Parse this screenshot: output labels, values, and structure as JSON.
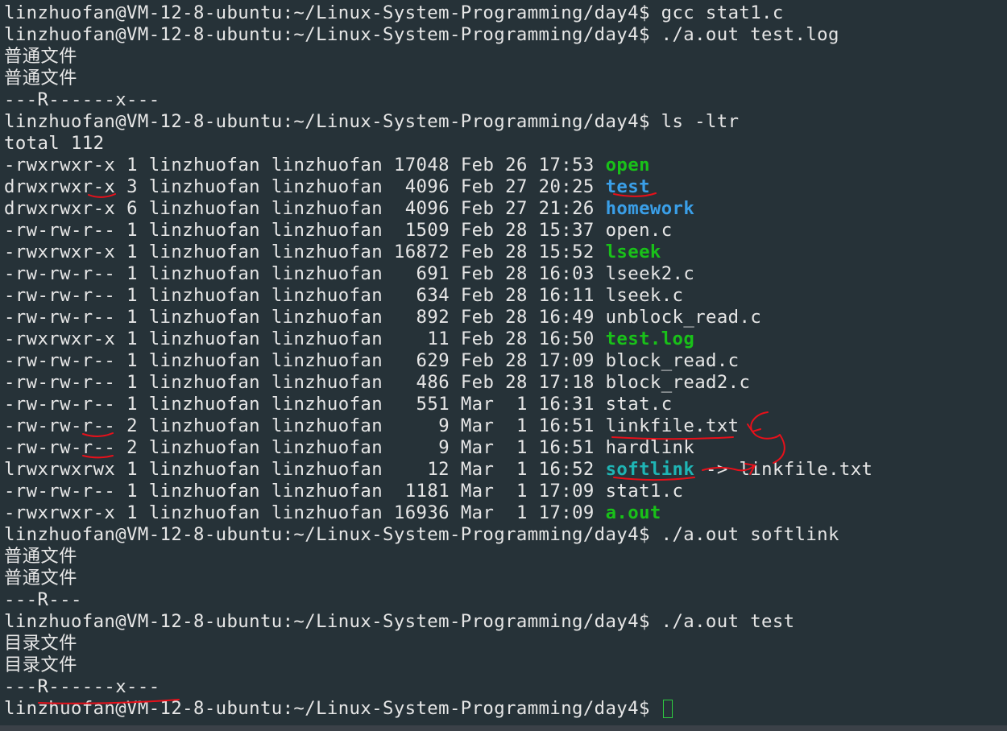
{
  "terminal": {
    "background": "#263238",
    "text_color": "#e6e6e6",
    "prompt": "linzhuofan@VM-12-8-ubuntu:~/Linux-System-Programming/day4$",
    "colors": {
      "executable": "#19c119",
      "directory": "#3a9fe8",
      "symlink": "#1fb5b5",
      "annotation": "#e8101a",
      "cursor": "#2ecc40"
    },
    "lines": [
      {
        "type": "cmd",
        "cmd": "gcc stat1.c"
      },
      {
        "type": "cmd",
        "cmd": "./a.out test.log"
      },
      {
        "type": "out",
        "text": "普通文件"
      },
      {
        "type": "out",
        "text": "普通文件"
      },
      {
        "type": "out",
        "text": "---R------x---"
      },
      {
        "type": "cmd",
        "cmd": "ls -ltr"
      },
      {
        "type": "out",
        "text": "total 112"
      },
      {
        "type": "ls",
        "perm": "-rwxrwxr-x",
        "links": "1",
        "owner": "linzhuofan",
        "group": "linzhuofan",
        "size": "17048",
        "month": "Feb",
        "day": "26",
        "time": "17:53",
        "name": "open",
        "kind": "exec"
      },
      {
        "type": "ls",
        "perm": "drwxrwxr-x",
        "links": "3",
        "owner": "linzhuofan",
        "group": "linzhuofan",
        "size": "4096",
        "month": "Feb",
        "day": "27",
        "time": "20:25",
        "name": "test",
        "kind": "dir"
      },
      {
        "type": "ls",
        "perm": "drwxrwxr-x",
        "links": "6",
        "owner": "linzhuofan",
        "group": "linzhuofan",
        "size": "4096",
        "month": "Feb",
        "day": "27",
        "time": "21:26",
        "name": "homework",
        "kind": "dir"
      },
      {
        "type": "ls",
        "perm": "-rw-rw-r--",
        "links": "1",
        "owner": "linzhuofan",
        "group": "linzhuofan",
        "size": "1509",
        "month": "Feb",
        "day": "28",
        "time": "15:37",
        "name": "open.c",
        "kind": "file"
      },
      {
        "type": "ls",
        "perm": "-rwxrwxr-x",
        "links": "1",
        "owner": "linzhuofan",
        "group": "linzhuofan",
        "size": "16872",
        "month": "Feb",
        "day": "28",
        "time": "15:52",
        "name": "lseek",
        "kind": "exec"
      },
      {
        "type": "ls",
        "perm": "-rw-rw-r--",
        "links": "1",
        "owner": "linzhuofan",
        "group": "linzhuofan",
        "size": "691",
        "month": "Feb",
        "day": "28",
        "time": "16:03",
        "name": "lseek2.c",
        "kind": "file"
      },
      {
        "type": "ls",
        "perm": "-rw-rw-r--",
        "links": "1",
        "owner": "linzhuofan",
        "group": "linzhuofan",
        "size": "634",
        "month": "Feb",
        "day": "28",
        "time": "16:11",
        "name": "lseek.c",
        "kind": "file"
      },
      {
        "type": "ls",
        "perm": "-rw-rw-r--",
        "links": "1",
        "owner": "linzhuofan",
        "group": "linzhuofan",
        "size": "892",
        "month": "Feb",
        "day": "28",
        "time": "16:49",
        "name": "unblock_read.c",
        "kind": "file"
      },
      {
        "type": "ls",
        "perm": "-rwxrwxr-x",
        "links": "1",
        "owner": "linzhuofan",
        "group": "linzhuofan",
        "size": "11",
        "month": "Feb",
        "day": "28",
        "time": "16:50",
        "name": "test.log",
        "kind": "exec"
      },
      {
        "type": "ls",
        "perm": "-rw-rw-r--",
        "links": "1",
        "owner": "linzhuofan",
        "group": "linzhuofan",
        "size": "629",
        "month": "Feb",
        "day": "28",
        "time": "17:09",
        "name": "block_read.c",
        "kind": "file"
      },
      {
        "type": "ls",
        "perm": "-rw-rw-r--",
        "links": "1",
        "owner": "linzhuofan",
        "group": "linzhuofan",
        "size": "486",
        "month": "Feb",
        "day": "28",
        "time": "17:18",
        "name": "block_read2.c",
        "kind": "file"
      },
      {
        "type": "ls",
        "perm": "-rw-rw-r--",
        "links": "1",
        "owner": "linzhuofan",
        "group": "linzhuofan",
        "size": "551",
        "month": "Mar",
        "day": "1",
        "time": "16:31",
        "name": "stat.c",
        "kind": "file"
      },
      {
        "type": "ls",
        "perm": "-rw-rw-r--",
        "links": "2",
        "owner": "linzhuofan",
        "group": "linzhuofan",
        "size": "9",
        "month": "Mar",
        "day": "1",
        "time": "16:51",
        "name": "linkfile.txt",
        "kind": "file"
      },
      {
        "type": "ls",
        "perm": "-rw-rw-r--",
        "links": "2",
        "owner": "linzhuofan",
        "group": "linzhuofan",
        "size": "9",
        "month": "Mar",
        "day": "1",
        "time": "16:51",
        "name": "hardlink",
        "kind": "file"
      },
      {
        "type": "ls",
        "perm": "lrwxrwxrwx",
        "links": "1",
        "owner": "linzhuofan",
        "group": "linzhuofan",
        "size": "12",
        "month": "Mar",
        "day": "1",
        "time": "16:52",
        "name": "softlink",
        "kind": "link",
        "target": "linkfile.txt"
      },
      {
        "type": "ls",
        "perm": "-rw-rw-r--",
        "links": "1",
        "owner": "linzhuofan",
        "group": "linzhuofan",
        "size": "1181",
        "month": "Mar",
        "day": "1",
        "time": "17:09",
        "name": "stat1.c",
        "kind": "file"
      },
      {
        "type": "ls",
        "perm": "-rwxrwxr-x",
        "links": "1",
        "owner": "linzhuofan",
        "group": "linzhuofan",
        "size": "16936",
        "month": "Mar",
        "day": "1",
        "time": "17:09",
        "name": "a.out",
        "kind": "exec"
      },
      {
        "type": "cmd",
        "cmd": "./a.out softlink"
      },
      {
        "type": "out",
        "text": "普通文件"
      },
      {
        "type": "out",
        "text": "普通文件"
      },
      {
        "type": "out",
        "text": "---R---"
      },
      {
        "type": "cmd",
        "cmd": "./a.out test"
      },
      {
        "type": "out",
        "text": "目录文件"
      },
      {
        "type": "out",
        "text": "目录文件"
      },
      {
        "type": "out",
        "text": "---R------x---"
      },
      {
        "type": "prompt_cursor"
      }
    ]
  }
}
